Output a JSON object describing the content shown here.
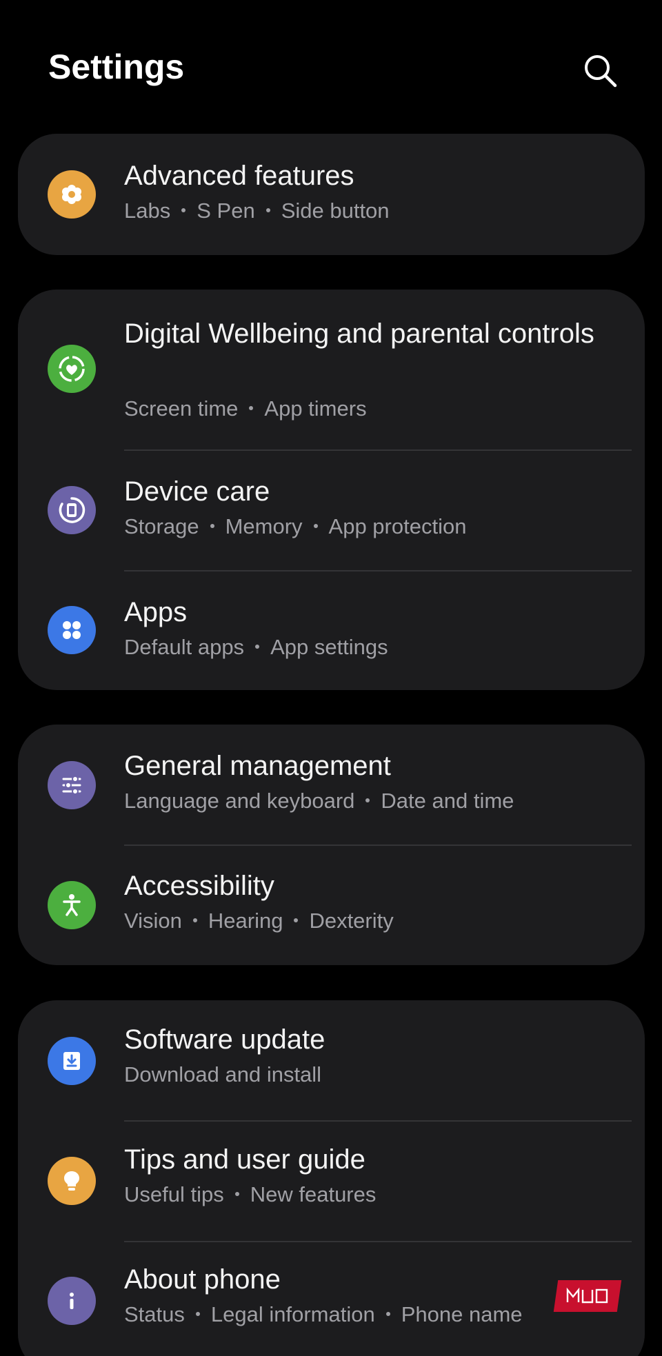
{
  "header": {
    "title": "Settings"
  },
  "cards": [
    {
      "rows": [
        {
          "title": "Advanced features",
          "subtitle": [
            "Labs",
            "S Pen",
            "Side button"
          ],
          "icon": "advanced-features-icon",
          "icon_color": "#e8a542"
        }
      ]
    },
    {
      "rows": [
        {
          "title": "Digital Wellbeing and parental controls",
          "subtitle": [
            "Screen time",
            "App timers"
          ],
          "icon": "digital-wellbeing-icon",
          "icon_color": "#4caf3f"
        },
        {
          "title": "Device care",
          "subtitle": [
            "Storage",
            "Memory",
            "App protection"
          ],
          "icon": "device-care-icon",
          "icon_color": "#6c63a8"
        },
        {
          "title": "Apps",
          "subtitle": [
            "Default apps",
            "App settings"
          ],
          "icon": "apps-icon",
          "icon_color": "#3c78e6"
        }
      ]
    },
    {
      "rows": [
        {
          "title": "General management",
          "subtitle": [
            "Language and keyboard",
            "Date and time"
          ],
          "icon": "general-management-icon",
          "icon_color": "#6c63a8"
        },
        {
          "title": "Accessibility",
          "subtitle": [
            "Vision",
            "Hearing",
            "Dexterity"
          ],
          "icon": "accessibility-icon",
          "icon_color": "#4caf3f"
        }
      ]
    },
    {
      "rows": [
        {
          "title": "Software update",
          "subtitle": [
            "Download and install"
          ],
          "icon": "software-update-icon",
          "icon_color": "#3c78e6"
        },
        {
          "title": "Tips and user guide",
          "subtitle": [
            "Useful tips",
            "New features"
          ],
          "icon": "tips-icon",
          "icon_color": "#e8a542"
        },
        {
          "title": "About phone",
          "subtitle": [
            "Status",
            "Legal information",
            "Phone name"
          ],
          "icon": "about-phone-icon",
          "icon_color": "#6c63a8"
        }
      ]
    }
  ],
  "watermark": {
    "text": "MUO",
    "color": "#c8102e"
  }
}
